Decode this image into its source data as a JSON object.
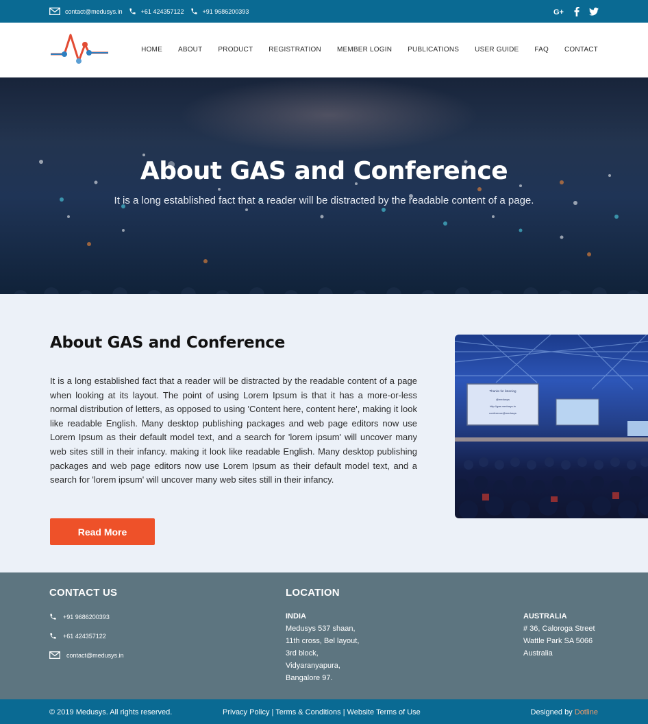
{
  "topbar": {
    "email": "contact@medusys.in",
    "phone1": "+61 424357122",
    "phone2": "+91 9686200393",
    "social": [
      "google-plus-icon",
      "facebook-icon",
      "twitter-icon"
    ]
  },
  "nav": {
    "items": [
      "HOME",
      "ABOUT",
      "PRODUCT",
      "REGISTRATION",
      "MEMBER LOGIN",
      "PUBLICATIONS",
      "USER GUIDE",
      "FAQ",
      "CONTACT"
    ]
  },
  "hero": {
    "title": "About GAS and Conference",
    "subtitle": "It is a long established fact that a reader will be distracted by the readable content of a page."
  },
  "about": {
    "title": "About GAS and Conference",
    "body": "It is a long established fact that a reader will be distracted by the readable content of a page when looking at its layout. The point of using Lorem Ipsum is that it has a more-or-less normal distribution of letters, as opposed to using 'Content here, content here', making it look like readable English. Many desktop publishing packages and web page editors now use Lorem Ipsum as their default model text, and a search for 'lorem ipsum' will uncover many web sites still in their infancy. making it look like readable English. Many desktop publishing packages and web page editors now use Lorem Ipsum as their default model text, and a search for 'lorem ipsum' will uncover many web sites still in their infancy.",
    "button": "Read More",
    "screen": {
      "line1": "Thanks for listening",
      "line2": "@medusys",
      "line3": "http://gas.medusys.in",
      "line4": "conference@medusys"
    }
  },
  "footer": {
    "contact_title": "CONTACT US",
    "phone1": "+91 9686200393",
    "phone2": "+61 424357122",
    "email": "contact@medusys.in",
    "location_title": "LOCATION",
    "india": {
      "title": "INDIA",
      "lines": [
        "Medusys 537 shaan,",
        "11th cross, Bel layout,",
        "3rd block,",
        "Vidyaranyapura,",
        "Bangalore 97."
      ]
    },
    "australia": {
      "title": "AUSTRALIA",
      "lines": [
        "# 36, Caloroga Street",
        "Wattle Park SA 5066",
        "Australia"
      ]
    }
  },
  "bottombar": {
    "copyright": "© 2019 Medusys. All rights reserved.",
    "privacy": "Privacy Policy",
    "terms": "Terms & Conditions",
    "website_terms": "Website Terms of Use",
    "designed_by": "Designed by",
    "designer": "Dotline"
  },
  "colors": {
    "topbar": "#0a6a93",
    "accent": "#ee5129",
    "about_bg": "#ecf1f8",
    "footer_bg": "#5d7580",
    "designer_link": "#f39c6b"
  }
}
